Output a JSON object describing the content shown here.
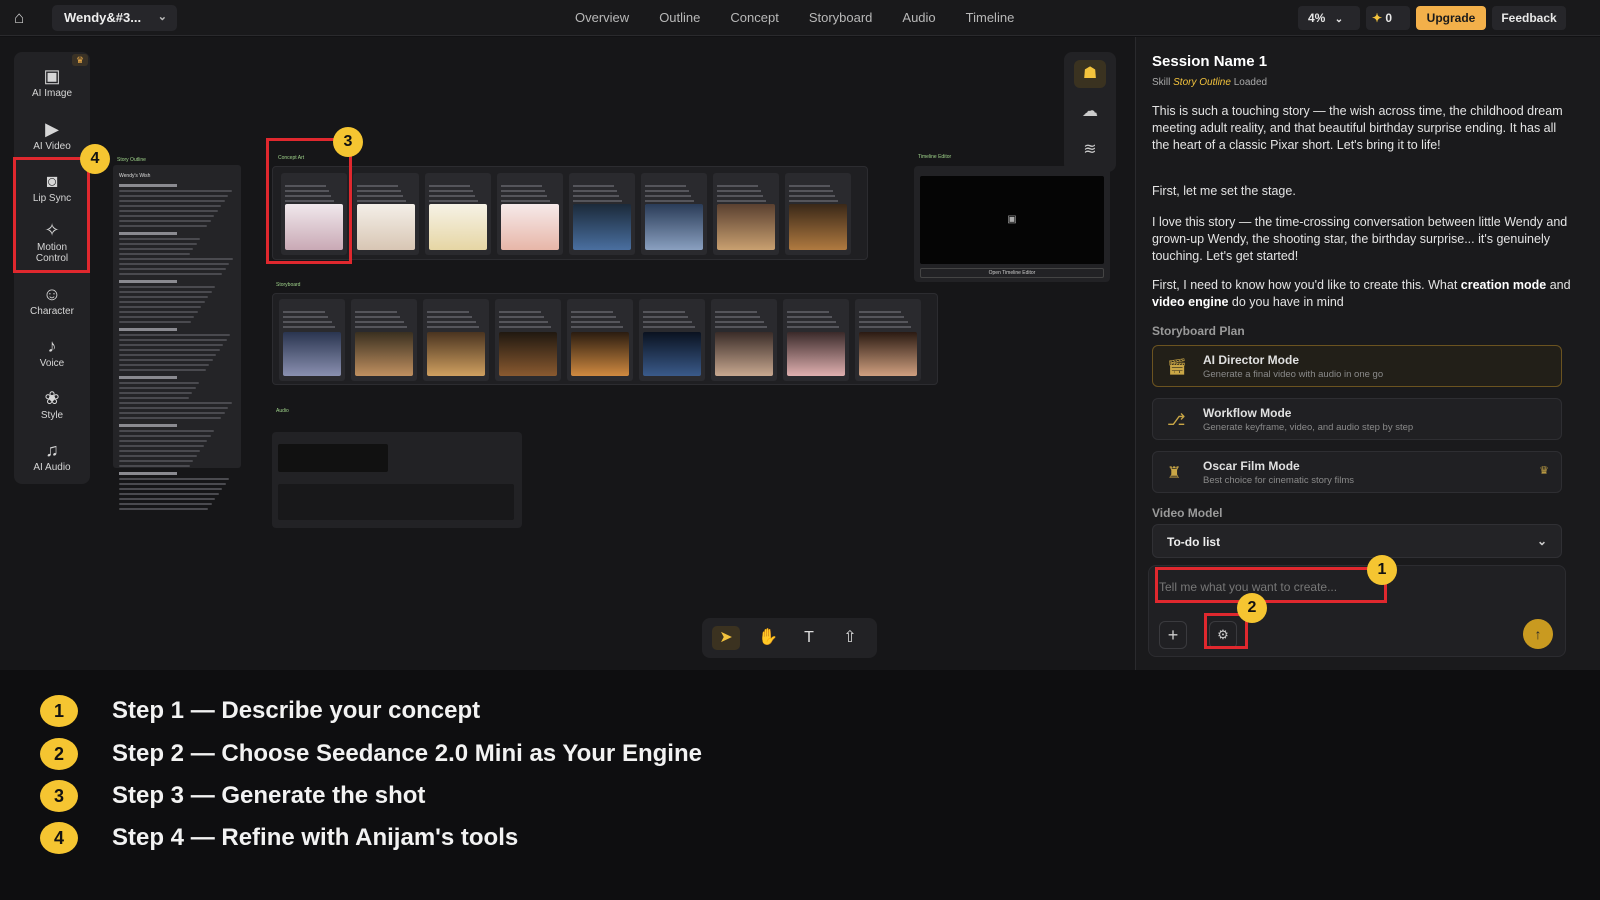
{
  "topbar": {
    "project": "Wendy&#3...",
    "nav": [
      "Overview",
      "Outline",
      "Concept",
      "Storyboard",
      "Audio",
      "Timeline"
    ],
    "zoom": "4%",
    "credits": "0",
    "upgrade": "Upgrade",
    "feedback": "Feedback"
  },
  "leftbar": {
    "tools": [
      {
        "label": "AI Image",
        "icon": "image-icon"
      },
      {
        "label": "AI Video",
        "icon": "video-icon"
      },
      {
        "label": "Lip Sync",
        "icon": "lipsync-icon"
      },
      {
        "label": "Motion Control",
        "icon": "motion-icon"
      },
      {
        "label": "Character",
        "icon": "character-icon"
      },
      {
        "label": "Voice",
        "icon": "voice-icon"
      },
      {
        "label": "Style",
        "icon": "style-icon"
      },
      {
        "label": "AI Audio",
        "icon": "audio-icon"
      }
    ]
  },
  "canvas": {
    "story_outline_title": "Story Outline",
    "concept_art_title": "Concept Art",
    "storyboard_title": "Storyboard",
    "audio_title": "Audio",
    "timeline_title": "Timeline Editor",
    "timeline_button": "Open Timeline Editor",
    "doc_heading": "Wendy's Wish"
  },
  "side": {
    "session_name": "Session Name 1",
    "skill_prefix": "Skill",
    "skill_name": "Story Outline",
    "skill_suffix": "Loaded",
    "p1": "This is such a touching story — the wish across time, the childhood dream meeting adult reality, and that beautiful birthday surprise ending. It has all the heart of a classic Pixar short. Let's bring it to life!",
    "p2": "First, let me set the stage.",
    "p3": "I love this story — the time-crossing conversation between little Wendy and grown-up Wendy, the shooting star, the birthday surprise... it's genuinely touching. Let's get started!",
    "p4_a": "First, I need to know how you'd like to create this. What ",
    "p4_b": "creation mode",
    "p4_c": " and ",
    "p4_d": "video engine",
    "p4_e": " do you have in mind",
    "storyboard_plan": "Storyboard Plan",
    "modes": [
      {
        "title": "AI Director Mode",
        "desc": "Generate a final video with audio in one go"
      },
      {
        "title": "Workflow Mode",
        "desc": "Generate keyframe, video, and audio step by step"
      },
      {
        "title": "Oscar Film Mode",
        "desc": "Best choice for cinematic story films"
      }
    ],
    "video_model_label": "Video Model",
    "video_model_value": "To-do list",
    "composer_placeholder": "Tell me what you want to create..."
  },
  "steps": [
    {
      "num": "1",
      "text": "Step 1 — Describe your concept"
    },
    {
      "num": "2",
      "text": "Step 2 — Choose Seedance 2.0 Mini as Your Engine"
    },
    {
      "num": "3",
      "text": "Step 3 — Generate the shot"
    },
    {
      "num": "4",
      "text": "Step 4 — Refine with Anijam's tools"
    }
  ],
  "callouts": [
    "1",
    "2",
    "3",
    "4"
  ],
  "colors": {
    "accent": "#f5c531",
    "highlight": "#e0282e",
    "upgrade": "#f3b04a"
  }
}
